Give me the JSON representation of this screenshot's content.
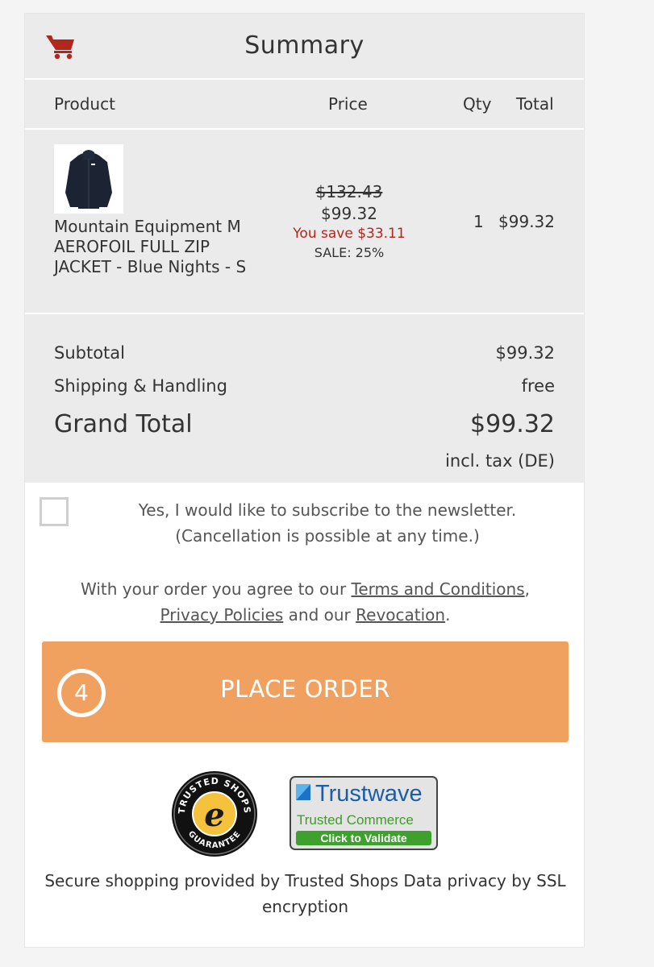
{
  "summary": {
    "title": "Summary"
  },
  "columns": {
    "product": "Product",
    "price": "Price",
    "qty": "Qty",
    "total": "Total"
  },
  "item": {
    "name": "Mountain Equipment M AEROFOIL FULL ZIP JACKET - Blue Nights - S",
    "old_price": "$132.43",
    "price": "$99.32",
    "savings": "You save $33.11",
    "sale": "SALE: 25%",
    "qty": "1",
    "total": "$99.32"
  },
  "totals": {
    "subtotal_label": "Subtotal",
    "subtotal_value": "$99.32",
    "shipping_label": "Shipping & Handling",
    "shipping_value": "free",
    "grand_label": "Grand Total",
    "grand_value": "$99.32",
    "tax_note": "incl. tax (DE)"
  },
  "newsletter": {
    "line1": "Yes, I would like to subscribe to the newsletter.",
    "line2": "(Cancellation is possible at any time.)"
  },
  "agreement": {
    "prefix": "With your order you agree to our ",
    "terms": "Terms and Conditions",
    "comma": ",",
    "privacy": "Privacy Policies",
    "middle": " and our ",
    "revocation": "Revocation",
    "suffix": "."
  },
  "order_button": {
    "step": "4",
    "label": "PLACE ORDER"
  },
  "badges": {
    "trusted_shops_top": "TRUSTED SHOPS",
    "trusted_shops_bottom": "GUARANTEE",
    "trusted_shops_letter": "e",
    "trustwave_name": "Trustwave",
    "trustwave_sub": "Trusted Commerce",
    "trustwave_cta": "Click to Validate"
  },
  "footer": {
    "secure_text": "Secure shopping provided by Trusted Shops Data privacy by SSL encryption"
  },
  "colors": {
    "accent": "#f0a160",
    "cart_icon": "#b3261e",
    "savings": "#b3261e",
    "panel_bg": "#ebebeb"
  },
  "icons": {
    "cart": "shopping-cart-icon"
  }
}
